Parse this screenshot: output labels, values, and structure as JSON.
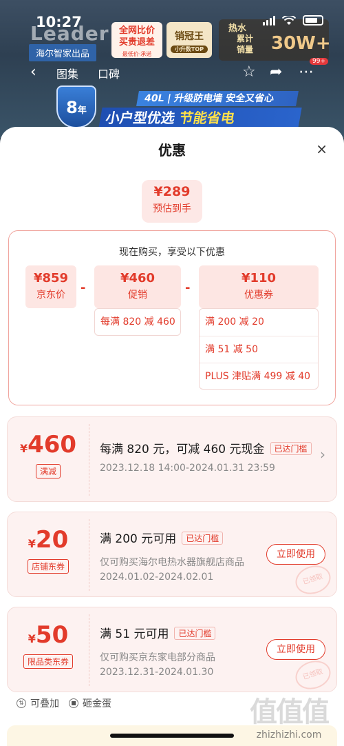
{
  "status_bar": {
    "time": "10:27"
  },
  "product": {
    "brand": "Leader",
    "brand_sub": "海尔智家出品",
    "badge_compare": "全网比价\n买贵退差",
    "badge_compare_sub": "最低价·承诺",
    "badge_champion": "销冠王",
    "badge_champion_sub": "小升数TOP",
    "badge_sales_top": "热水",
    "badge_sales_label": "累计\n销量",
    "badge_sales_value": "30W+",
    "years": "8",
    "years_unit": "年",
    "banner_line1": "40L | 升级防电墙 安全又省心",
    "banner_line2_a": "小户型优选 ",
    "banner_line2_b": "节能省电"
  },
  "nav": {
    "back": "‹",
    "tabs": [
      "图集",
      "口碑"
    ],
    "more_count": "99+"
  },
  "sheet": {
    "title": "优惠",
    "close": "×",
    "estimate": {
      "price": "¥289",
      "label": "预估到手"
    },
    "calc": {
      "heading": "现在购买，享受以下优惠",
      "jd_price": {
        "value": "¥859",
        "label": "京东价"
      },
      "promo": {
        "value": "¥460",
        "label": "促销",
        "items": [
          "每满 820 减 460"
        ]
      },
      "coupon": {
        "value": "¥110",
        "label": "优惠券",
        "items": [
          "满 200 减 20",
          "满 51 减 50",
          "PLUS 津贴满 499 减 40"
        ]
      },
      "operator": "-"
    },
    "offers": [
      {
        "amount": "460",
        "tag": "满减",
        "title": "每满 820 元，可减 460 元现金",
        "reached": "已达门槛",
        "desc": "",
        "date": "2023.12.18 14:00-2024.01.31 23:59",
        "has_button": false
      },
      {
        "amount": "20",
        "tag": "店铺东券",
        "title": "满 200 元可用",
        "reached": "已达门槛",
        "desc": "仅可购买海尔电热水器旗舰店商品",
        "date": "2024.01.02-2024.02.01",
        "button": "立即使用",
        "stamp": "已领取",
        "has_button": true
      },
      {
        "amount": "50",
        "tag": "限品类东券",
        "title": "满 51 元可用",
        "reached": "已达门槛",
        "desc": "仅可购买京东家电部分商品",
        "date": "2023.12.31-2024.01.30",
        "button": "立即使用",
        "stamp": "已领取",
        "has_button": true
      }
    ],
    "currency": "¥",
    "legend": [
      "可叠加",
      "砸金蛋"
    ]
  },
  "watermark": {
    "logo": "值值值",
    "url": "zhizhizhi.com"
  }
}
